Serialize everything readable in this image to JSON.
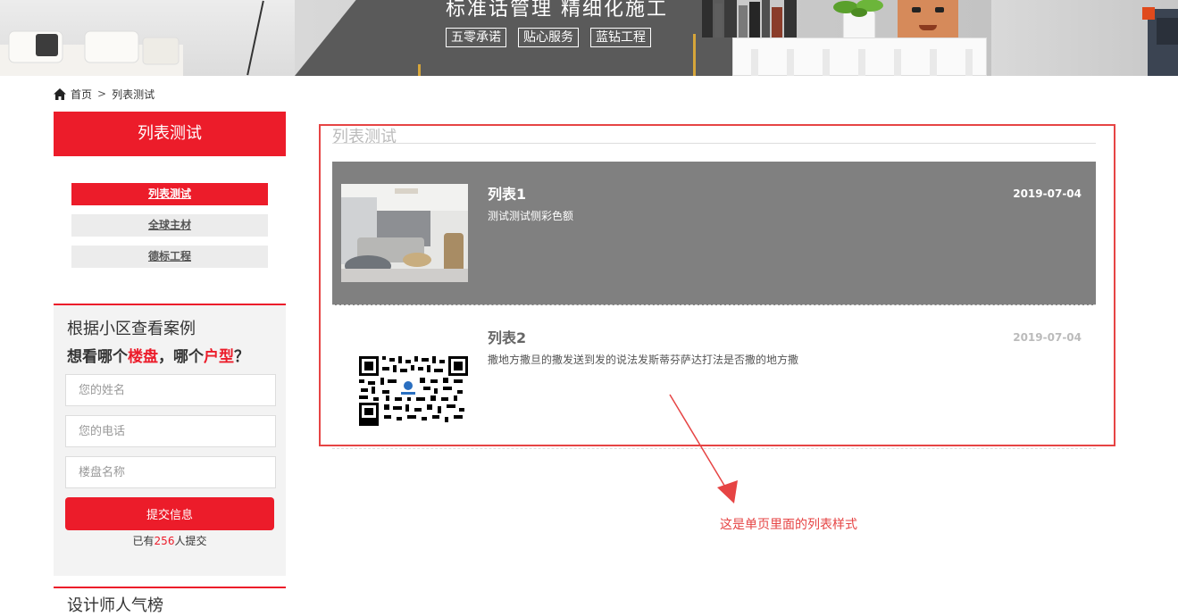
{
  "banner": {
    "headline": "标准话管理 精细化施工",
    "tags": [
      "五零承诺",
      "贴心服务",
      "蓝钻工程"
    ]
  },
  "breadcrumb": {
    "home": "首页",
    "separator": ">",
    "current": "列表测试"
  },
  "sidebar": {
    "title": "列表测试",
    "items": [
      {
        "label": "列表测试",
        "active": true
      },
      {
        "label": "全球主材",
        "active": false
      },
      {
        "label": "德标工程",
        "active": false
      }
    ]
  },
  "case_form": {
    "title": "根据小区查看案例",
    "subtitle_parts": [
      "想看哪个",
      "楼盘",
      "，哪个",
      "户型",
      "？"
    ],
    "name_placeholder": "您的姓名",
    "phone_placeholder": "您的电话",
    "estate_placeholder": "楼盘名称",
    "submit_label": "提交信息",
    "count_prefix": "已有",
    "count_value": "256",
    "count_suffix": "人提交"
  },
  "designer": {
    "title": "设计师人气榜"
  },
  "main": {
    "title": "列表测试",
    "items": [
      {
        "title": "列表1",
        "desc": "测试测试侧彩色额",
        "date": "2019-07-04",
        "thumb": "living-room-photo"
      },
      {
        "title": "列表2",
        "desc": "撒地方撒旦的撒发送到发的说法发斯蒂芬萨达打法是否撒的地方撒",
        "date": "2019-07-04",
        "thumb": "qr-code"
      }
    ]
  },
  "annotation": {
    "text": "这是单页里面的列表样式",
    "color": "#e64444"
  },
  "colors": {
    "accent": "#ec1c2a",
    "hover_bg": "#808080"
  }
}
